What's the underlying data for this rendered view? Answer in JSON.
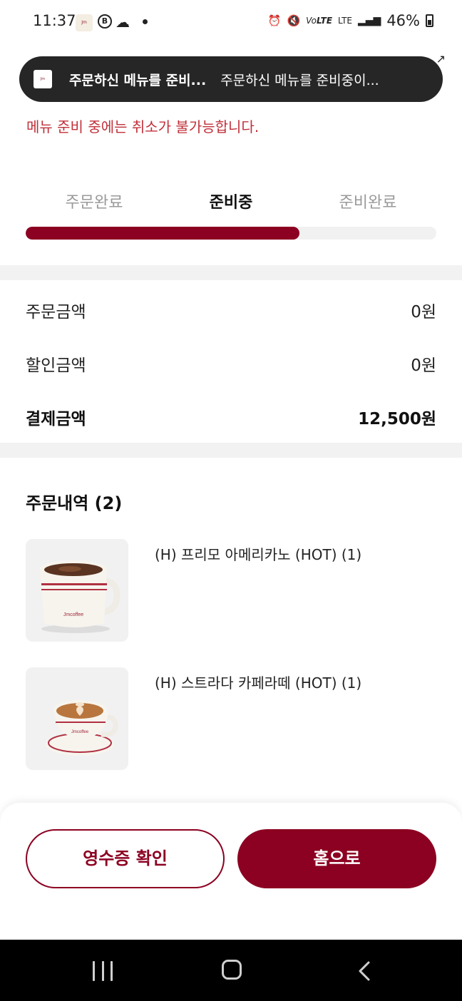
{
  "status_bar": {
    "time": "11:37",
    "app_icon_text": "Jmcoffee",
    "b_icon": "B",
    "volte": "VoLTE",
    "lte": "LTE",
    "battery": "46%"
  },
  "toast": {
    "icon_text": "Jmcoffee",
    "title": "주문하신 메뉴를 준비...",
    "body": "주문하신 메뉴를 준비중이..."
  },
  "notice": "메뉴 준비 중에는 취소가 불가능합니다.",
  "steps": [
    "주문완료",
    "준비중",
    "준비완료"
  ],
  "progress": {
    "active_step": 1,
    "fraction": 0.667,
    "accent": "#8c0021"
  },
  "amounts": {
    "order_label": "주문금액",
    "order_value": "0원",
    "discount_label": "할인금액",
    "discount_value": "0원",
    "payment_label": "결제금액",
    "payment_value": "12,500원"
  },
  "history": {
    "title": "주문내역 (2)",
    "items": [
      {
        "name": "(H) 프리모 아메리카노 (HOT) (1)",
        "image": "americano-mug-icon"
      },
      {
        "name": "(H) 스트라다 카페라떼 (HOT) (1)",
        "image": "latte-cup-icon"
      }
    ]
  },
  "buttons": {
    "receipt": "영수증 확인",
    "home": "홈으로"
  },
  "nav": {
    "recents": "recents-icon",
    "home": "home-icon",
    "back": "back-icon"
  }
}
